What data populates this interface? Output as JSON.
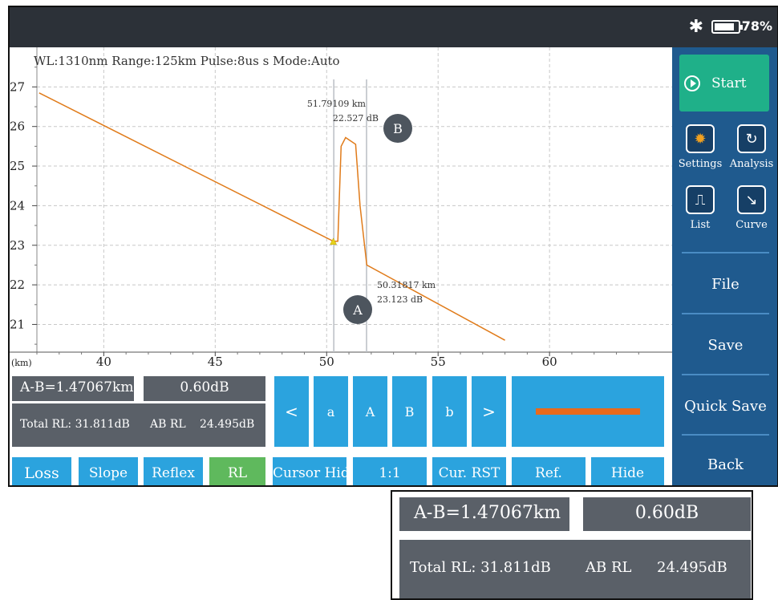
{
  "status": {
    "battery": "78%"
  },
  "chart": {
    "header": "WL:1310nm  Range:125km  Pulse:8us s  Mode:Auto",
    "unit_label": "(km)",
    "x_ticks": [
      "40",
      "45",
      "50",
      "55",
      "60"
    ],
    "y_ticks": [
      "27",
      "26",
      "25",
      "24",
      "23",
      "22",
      "21"
    ],
    "marker_b": {
      "letter": "B",
      "line1": "51.79109 km",
      "line2": "22.527 dB"
    },
    "marker_a": {
      "letter": "A",
      "line1": "50.31817 km",
      "line2": "23.123 dB"
    }
  },
  "chart_data": {
    "type": "line",
    "xlim": [
      37,
      65.5
    ],
    "ylim": [
      20.3,
      28.0
    ],
    "series": [
      {
        "values": [
          [
            37.1,
            26.85
          ],
          [
            50.3,
            23.1
          ],
          [
            50.5,
            23.1
          ],
          [
            50.65,
            25.5
          ],
          [
            50.85,
            25.72
          ],
          [
            51.3,
            25.55
          ],
          [
            51.5,
            24.0
          ],
          [
            51.8,
            22.5
          ],
          [
            58.0,
            20.6
          ]
        ]
      }
    ],
    "cursors_x": [
      50.32,
      51.79
    ]
  },
  "sidebar": {
    "start": "Start",
    "settings": "Settings",
    "analysis": "Analysis",
    "list": "List",
    "curve": "Curve",
    "file": "File",
    "save": "Save",
    "quick_save": "Quick Save",
    "back": "Back"
  },
  "panel": {
    "ab_distance": "A-B=1.47067km",
    "ab_loss": "0.60dB",
    "total_rl": "Total RL: 31.811dB",
    "ab_rl_label": "AB RL",
    "ab_rl_value": "24.495dB",
    "nav": [
      "<",
      "a",
      "A",
      "B",
      "b",
      ">"
    ],
    "modes": [
      "Loss",
      "Slope",
      "Reflex",
      "RL"
    ],
    "actions": [
      "Cursor Hide",
      "1:1",
      "Cur. RST",
      "Ref.",
      "Hide"
    ]
  },
  "zoom": {
    "ab_distance": "A-B=1.47067km",
    "ab_loss": "0.60dB",
    "total_rl": "Total RL: 31.811dB",
    "ab_rl_label": "AB RL",
    "ab_rl_value": "24.495dB"
  },
  "colors": {
    "trace": "#e07b1a",
    "sidebar": "#1f5a8e",
    "button": "#2ba3de",
    "dark_box": "#5a6068",
    "start": "#1fb089",
    "active": "#5fb95d"
  }
}
